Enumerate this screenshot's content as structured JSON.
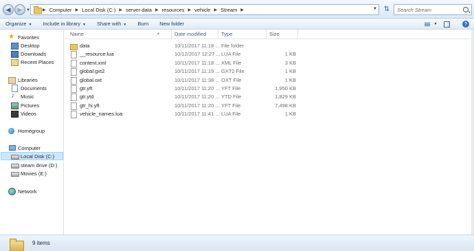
{
  "address": {
    "breadcrumbs": [
      "Computer",
      "Local Disk (C:)",
      "server-data",
      "resources",
      "vehicle",
      "Stream"
    ],
    "search_placeholder": "Search Stream"
  },
  "toolbar": {
    "organize": "Organize",
    "include_in_library": "Include in library",
    "share_with": "Share with",
    "burn": "Burn",
    "new_folder": "New folder"
  },
  "nav": {
    "favorites_header": "Favorites",
    "favorites": [
      "Desktop",
      "Downloads",
      "Recent Places"
    ],
    "libraries_header": "Libraries",
    "libraries": [
      "Documents",
      "Music",
      "Pictures",
      "Videos"
    ],
    "homegroup": "Homegroup",
    "computer_header": "Computer",
    "drives": [
      "Local Disk (C:)",
      "steam drive (D:)",
      "Movies (E:)"
    ],
    "network": "Network"
  },
  "columns": {
    "name": "Name",
    "date": "Date modified",
    "type": "Type",
    "size": "Size"
  },
  "files": [
    {
      "name": "data",
      "date": "10/11/2017 11:18 ...",
      "type": "File folder",
      "size": "",
      "kind": "folder"
    },
    {
      "name": "__resource.lua",
      "date": "10/12/2017 12:27 ...",
      "type": "LUA File",
      "size": "1 KB",
      "kind": "file"
    },
    {
      "name": "content.xml",
      "date": "10/11/2017 11:18 ...",
      "type": "XML File",
      "size": "3 KB",
      "kind": "file"
    },
    {
      "name": "global.gxt2",
      "date": "10/11/2017 11:19 ...",
      "type": "GXT2 File",
      "size": "1 KB",
      "kind": "file"
    },
    {
      "name": "global.oxt",
      "date": "10/11/2017 11:38 ...",
      "type": "OXT File",
      "size": "1 KB",
      "kind": "file"
    },
    {
      "name": "gtr.yft",
      "date": "10/11/2017 11:20 ...",
      "type": "YFT File",
      "size": "1,950 KB",
      "kind": "file"
    },
    {
      "name": "gtr.ytd",
      "date": "10/11/2017 11:20 ...",
      "type": "YTD File",
      "size": "1,829 KB",
      "kind": "file"
    },
    {
      "name": "gtr_hi.yft",
      "date": "10/11/2017 11:20 ...",
      "type": "YFT File",
      "size": "7,498 KB",
      "kind": "file"
    },
    {
      "name": "vehicle_names.lua",
      "date": "10/11/2017 11:41 ...",
      "type": "LUA File",
      "size": "1 KB",
      "kind": "file"
    }
  ],
  "status": {
    "item_count": "9 items"
  }
}
